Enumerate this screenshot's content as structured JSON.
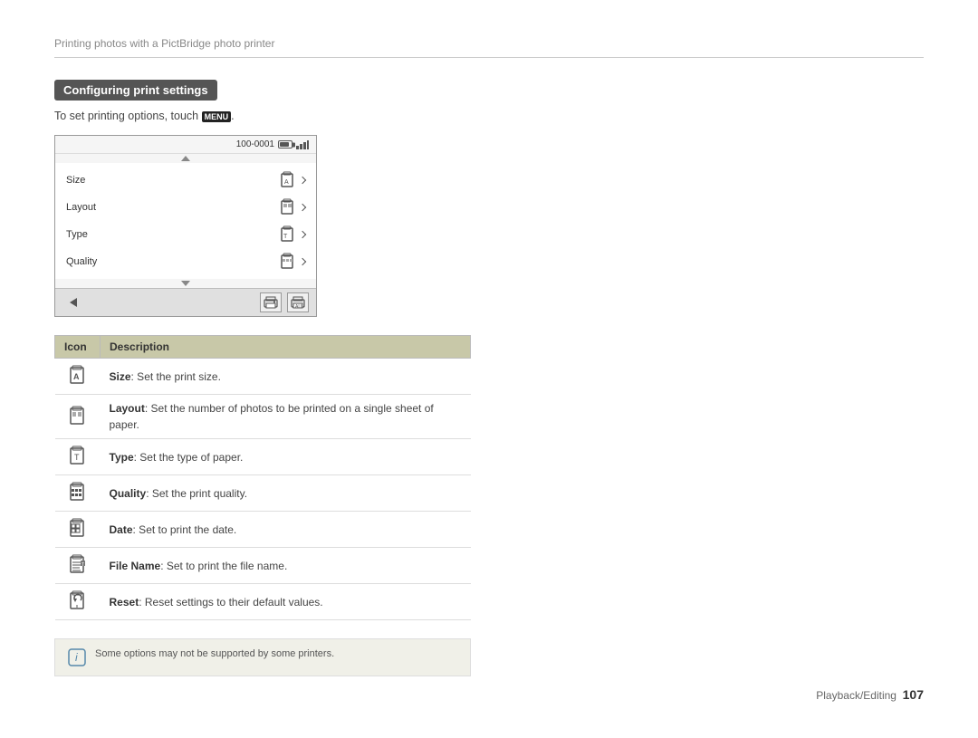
{
  "header": {
    "breadcrumb": "Printing photos with a PictBridge photo printer"
  },
  "section": {
    "heading": "Configuring print settings",
    "instruction": "To set printing options, touch",
    "menu_button": "MENU"
  },
  "camera_screen": {
    "file_info": "100-0001",
    "menu_items": [
      {
        "label": "Size"
      },
      {
        "label": "Layout"
      },
      {
        "label": "Type"
      },
      {
        "label": "Quality"
      }
    ]
  },
  "table": {
    "col_icon": "Icon",
    "col_desc": "Description",
    "rows": [
      {
        "icon": "size-icon",
        "bold": "Size",
        "text": ": Set the print size."
      },
      {
        "icon": "layout-icon",
        "bold": "Layout",
        "text": ": Set the number of photos to be printed on a single sheet of paper."
      },
      {
        "icon": "type-icon",
        "bold": "Type",
        "text": ": Set the type of paper."
      },
      {
        "icon": "quality-icon",
        "bold": "Quality",
        "text": ": Set the print quality."
      },
      {
        "icon": "date-icon",
        "bold": "Date",
        "text": ": Set to print the date."
      },
      {
        "icon": "filename-icon",
        "bold": "File Name",
        "text": ": Set to print the file name."
      },
      {
        "icon": "reset-icon",
        "bold": "Reset",
        "text": ": Reset settings to their default values."
      }
    ]
  },
  "note": {
    "text": "Some options may not be supported by some printers."
  },
  "footer": {
    "label": "Playback/Editing",
    "page": "107"
  }
}
